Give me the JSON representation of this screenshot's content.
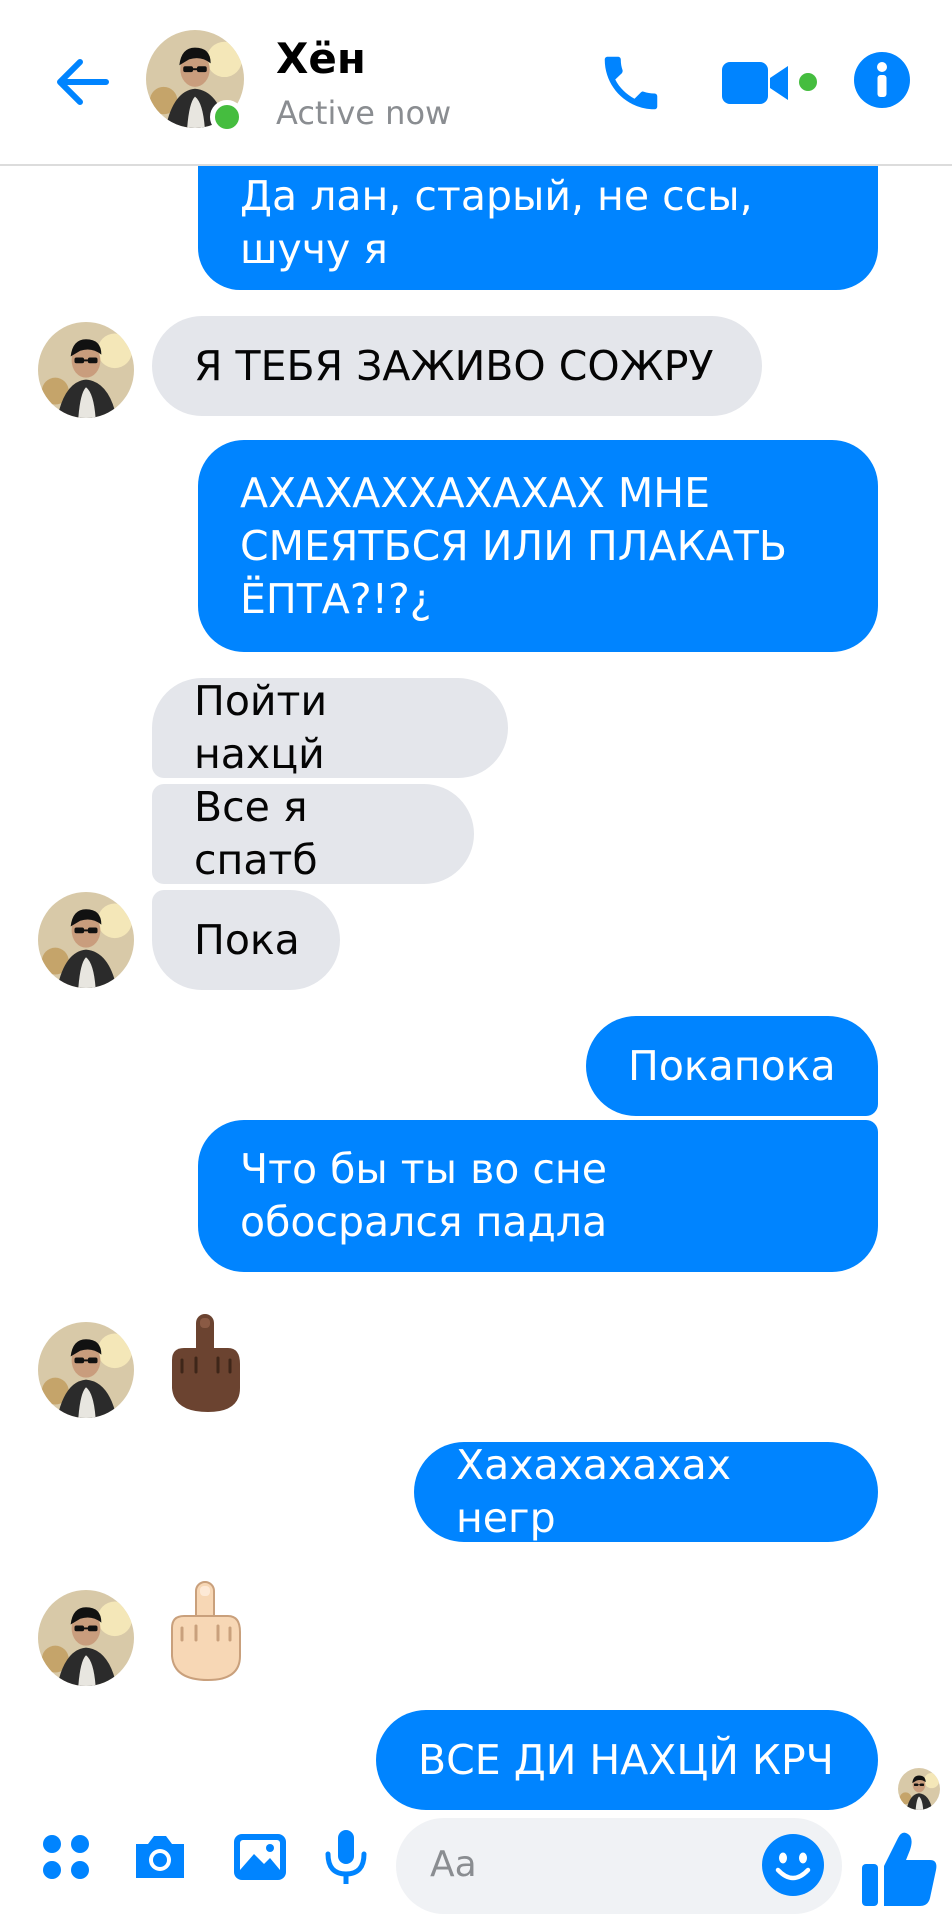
{
  "header": {
    "name": "Хён",
    "status": "Active now"
  },
  "messages": [
    {
      "side": "out",
      "text": "Да лан, старый, не ссы, шучу я"
    },
    {
      "side": "in",
      "text": "Я ТЕБЯ ЗАЖИВО СОЖРУ"
    },
    {
      "side": "out",
      "text": "АХАХАХХАХАХАХ МНЕ СМЕЯТБСЯ ИЛИ ПЛАКАТЬ ЁПТА?!?¿"
    },
    {
      "side": "in",
      "text": "Пойти нахцй"
    },
    {
      "side": "in",
      "text": "Все я спатб"
    },
    {
      "side": "in",
      "text": "Пока"
    },
    {
      "side": "out",
      "text": "Покапока"
    },
    {
      "side": "out",
      "text": "Что бы ты во сне обосрался падла"
    },
    {
      "side": "in",
      "emoji": "middle-finger-dark-skin"
    },
    {
      "side": "out",
      "text": "Хахахахахах негр"
    },
    {
      "side": "in",
      "emoji": "middle-finger-light-skin"
    },
    {
      "side": "out",
      "text": "ВСЕ ДИ НАХЦЙ КРЧ"
    }
  ],
  "composer": {
    "placeholder": "Aa"
  },
  "colors": {
    "accent": "#0084ff",
    "incoming_bubble": "#e4e6eb",
    "presence": "#45bd3f"
  },
  "icons": [
    "back-arrow-icon",
    "phone-icon",
    "video-camera-icon",
    "info-icon",
    "apps-icon",
    "camera-icon",
    "image-icon",
    "microphone-icon",
    "emoji-icon",
    "thumbs-up-icon"
  ]
}
